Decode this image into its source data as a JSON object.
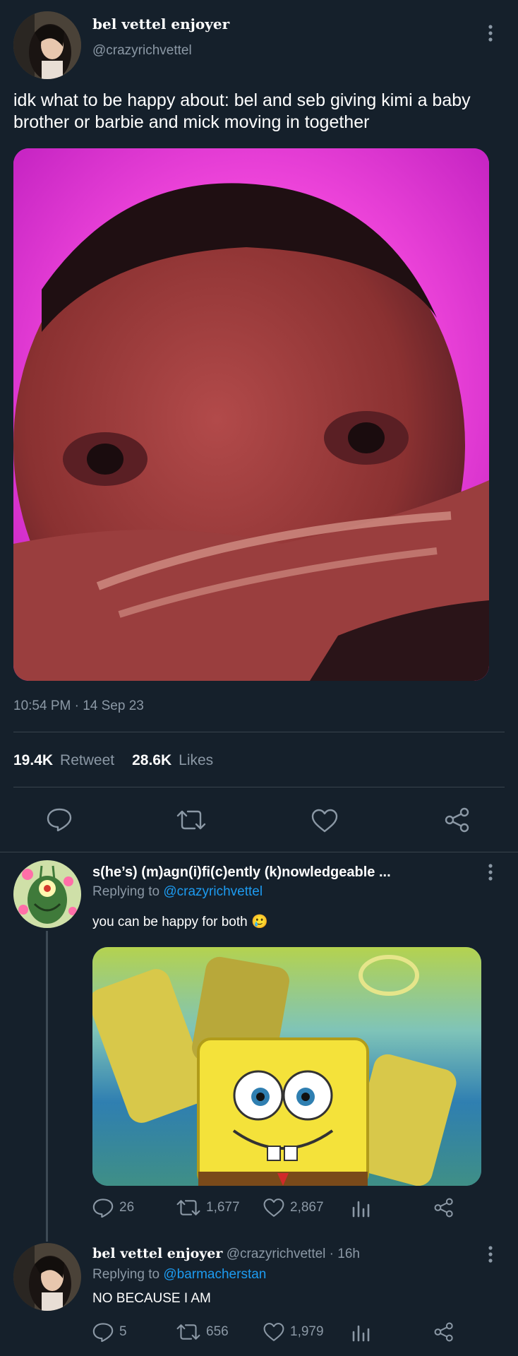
{
  "main_tweet": {
    "display_name": "bel vettel enjoyer",
    "handle": "@crazyrichvettel",
    "text": "idk what to be happy about: bel and seb giving kimi a baby brother or barbie and mick moving in together",
    "timestamp": "10:54 PM · 14 Sep 23",
    "retweets_count": "19.4K",
    "retweets_label": "Retweet",
    "likes_count": "28.6K",
    "likes_label": "Likes"
  },
  "reply1": {
    "display_name": "s(he’s) (m)agn(i)fi(c)ently (k)nowledgeable ...",
    "replying_label": "Replying to",
    "replying_handle": "@crazyrichvettel",
    "text": "you can be happy for both 🥲",
    "replies": "26",
    "retweets": "1,677",
    "likes": "2,867"
  },
  "reply2": {
    "display_name": "bel vettel enjoyer",
    "handle_time": "@crazyrichvettel · 16h",
    "replying_label": "Replying to",
    "replying_handle": "@barmacherstan",
    "text": "NO BECAUSE I AM",
    "replies": "5",
    "retweets": "656",
    "likes": "1,979"
  },
  "colors": {
    "background": "#15202b",
    "muted": "#8b98a5",
    "link": "#1d9bf0",
    "divider": "#38444d",
    "meme_bg": "#e13ad8"
  },
  "icons": [
    "more-icon",
    "reply-icon",
    "retweet-icon",
    "like-icon",
    "share-icon",
    "analytics-icon"
  ]
}
